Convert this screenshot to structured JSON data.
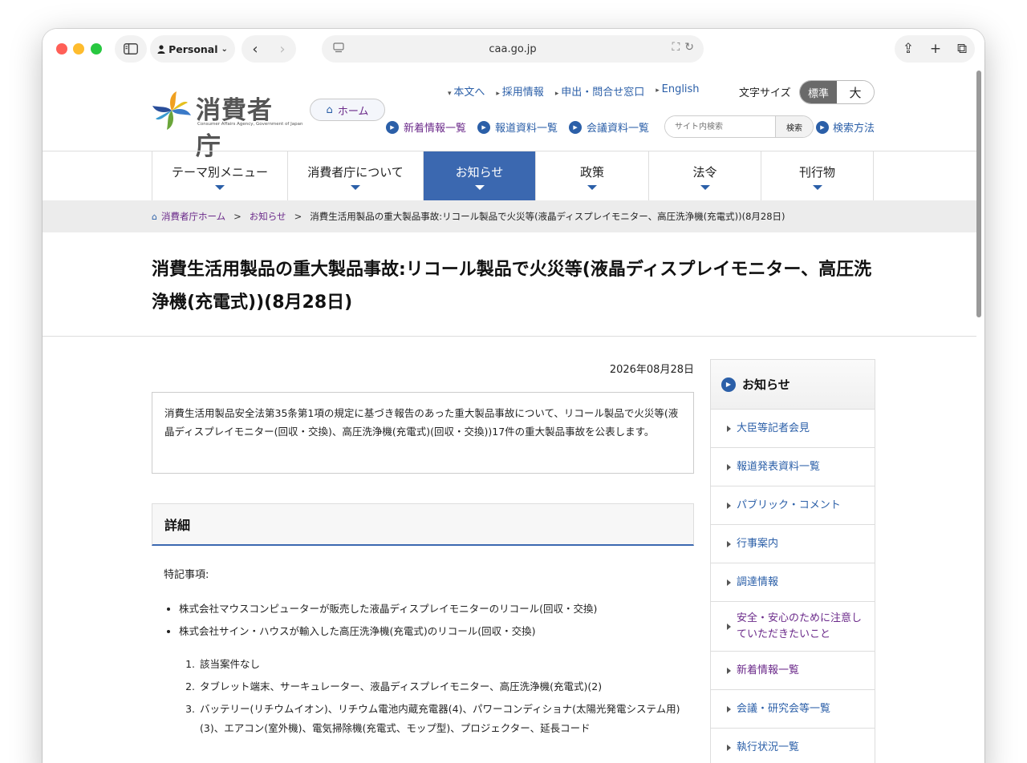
{
  "browser": {
    "profile": "Personal",
    "url": "caa.go.jp"
  },
  "header": {
    "logo_text": "消費者庁",
    "logo_sub": "Consumer Affairs Agency, Government of Japan",
    "home": "ホーム",
    "top_links": [
      "本文へ",
      "採用情報",
      "申出・問合せ窓口",
      "English"
    ],
    "font_size_label": "文字サイズ",
    "font_standard": "標準",
    "font_large": "大",
    "sub_links": [
      "新着情報一覧",
      "報道資料一覧",
      "会議資料一覧"
    ],
    "search_placeholder": "サイト内検索",
    "search_button": "検索",
    "search_howto": "検索方法"
  },
  "gnav": [
    "テーマ別メニュー",
    "消費者庁について",
    "お知らせ",
    "政策",
    "法令",
    "刊行物"
  ],
  "breadcrumb": {
    "home": "消費者庁ホーム",
    "section": "お知らせ",
    "current": "消費生活用製品の重大製品事故:リコール製品で火災等(液晶ディスプレイモニター、高圧洗浄機(充電式))(8月28日)"
  },
  "article": {
    "title": "消費生活用製品の重大製品事故:リコール製品で火災等(液晶ディスプレイモニター、高圧洗浄機(充電式))(8月28日)",
    "date": "2026年08月28日",
    "summary": "消費生活用製品安全法第35条第1項の規定に基づき報告のあった重大製品事故について、リコール製品で火災等(液晶ディスプレイモニター(回収・交換)、高圧洗浄機(充電式)(回収・交換))17件の重大製品事故を公表します。",
    "detail_heading": "詳細",
    "note_label": "特記事項:",
    "bullets": [
      "株式会社マウスコンピューターが販売した液晶ディスプレイモニターのリコール(回収・交換)",
      "株式会社サイン・ハウスが輸入した高圧洗浄機(充電式)のリコール(回収・交換)"
    ],
    "numbered": [
      "該当案件なし",
      "タブレット端末、サーキュレーター、液晶ディスプレイモニター、高圧洗浄機(充電式)(2)",
      "バッテリー(リチウムイオン)、リチウム電池内蔵充電器(4)、パワーコンディショナ(太陽光発電システム用)(3)、エアコン(室外機)、電気掃除機(充電式、モップ型)、プロジェクター、延長コード"
    ]
  },
  "sidebar": {
    "heading": "お知らせ",
    "items": [
      "大臣等記者会見",
      "報道発表資料一覧",
      "パブリック・コメント",
      "行事案内",
      "調達情報",
      "安全・安心のために注意していただきたいこと",
      "新着情報一覧",
      "会議・研究会等一覧",
      "執行状況一覧"
    ]
  }
}
